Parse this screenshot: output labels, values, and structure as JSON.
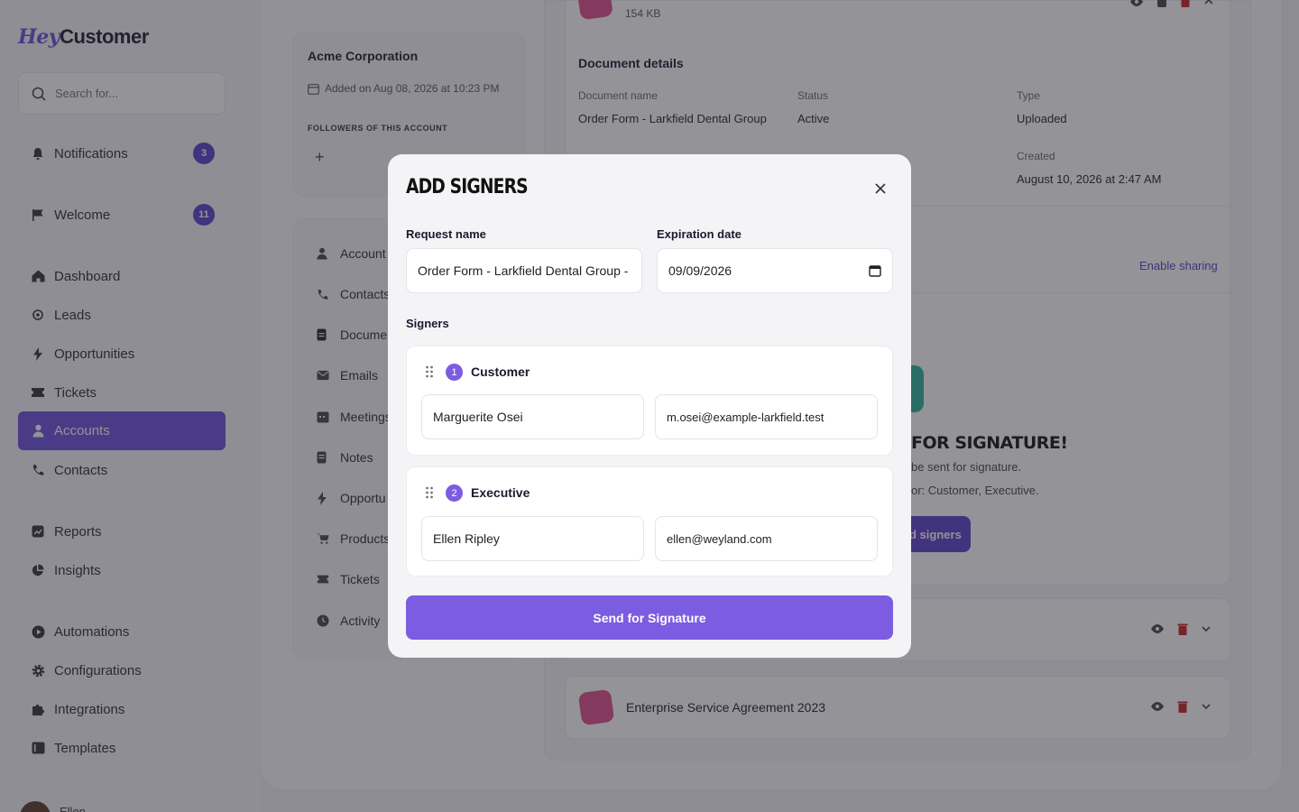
{
  "app": {
    "logo_hey": "Hey",
    "logo_customer": "Customer"
  },
  "search": {
    "placeholder": "Search for..."
  },
  "sidebar": {
    "items": [
      {
        "label": "Notifications",
        "icon": "bell-icon",
        "badge": "3"
      },
      {
        "label": "Welcome",
        "icon": "flag-icon",
        "badge": "11"
      },
      {
        "label": "Dashboard",
        "icon": "home-icon"
      },
      {
        "label": "Leads",
        "icon": "target-icon"
      },
      {
        "label": "Opportunities",
        "icon": "bolt-icon"
      },
      {
        "label": "Tickets",
        "icon": "ticket-icon"
      },
      {
        "label": "Accounts",
        "icon": "user-icon",
        "active": true
      },
      {
        "label": "Contacts",
        "icon": "phone-icon"
      },
      {
        "label": "Reports",
        "icon": "chart-icon"
      },
      {
        "label": "Insights",
        "icon": "pie-icon"
      },
      {
        "label": "Automations",
        "icon": "play-icon"
      },
      {
        "label": "Configurations",
        "icon": "gear-icon"
      },
      {
        "label": "Integrations",
        "icon": "puzzle-icon"
      },
      {
        "label": "Templates",
        "icon": "template-icon"
      }
    ],
    "user_name": "Ellen"
  },
  "account": {
    "name": "Acme Corporation",
    "added": "Added on Aug 08, 2026 at 10:23 PM",
    "followers_label": "Followers of this account"
  },
  "account_nav": [
    {
      "label": "Account",
      "icon": "user-icon"
    },
    {
      "label": "Contacts",
      "icon": "phone-icon"
    },
    {
      "label": "Documen",
      "icon": "document-icon"
    },
    {
      "label": "Emails",
      "icon": "mail-icon"
    },
    {
      "label": "Meetings",
      "icon": "calendar-icon"
    },
    {
      "label": "Notes",
      "icon": "note-icon"
    },
    {
      "label": "Opportu",
      "icon": "bolt-icon"
    },
    {
      "label": "Products",
      "icon": "cart-icon"
    },
    {
      "label": "Tickets",
      "icon": "ticket-icon"
    },
    {
      "label": "Activity",
      "icon": "clock-icon"
    }
  ],
  "document": {
    "file_size": "154 KB",
    "details_title": "Document details",
    "name_label": "Document name",
    "name_value": "Order Form - Larkfield Dental Group",
    "status_label": "Status",
    "status_value": "Active",
    "type_label": "Type",
    "type_value": "Uploaded",
    "created_label": "Created",
    "created_value": "August 10, 2026 at 2:47 AM",
    "enable_sharing": "Enable sharing",
    "signature_title": "FOR SIGNATURE!",
    "signature_sub1": "be sent for signature.",
    "signature_sub2": "or: Customer, Executive.",
    "add_signers_partial": "d signers"
  },
  "doc_rows": [
    {
      "title": ""
    },
    {
      "title": "Enterprise Service Agreement 2023"
    }
  ],
  "modal": {
    "title": "Add Signers",
    "request_label": "Request name",
    "request_value": "Order Form - Larkfield Dental Group - S",
    "expiration_label": "Expiration date",
    "expiration_value": "09/09/2026",
    "signers_label": "Signers",
    "signers": [
      {
        "number": "1",
        "role": "Customer",
        "name": "Marguerite Osei",
        "email": "m.osei@example-larkfield.test"
      },
      {
        "number": "2",
        "role": "Executive",
        "name": "Ellen Ripley",
        "email": "ellen@weyland.com"
      }
    ],
    "send_label": "Send for Signature"
  },
  "colors": {
    "accent": "#7c5ce0",
    "accent_dark": "#5a3fc8",
    "danger": "#c81e1e"
  }
}
